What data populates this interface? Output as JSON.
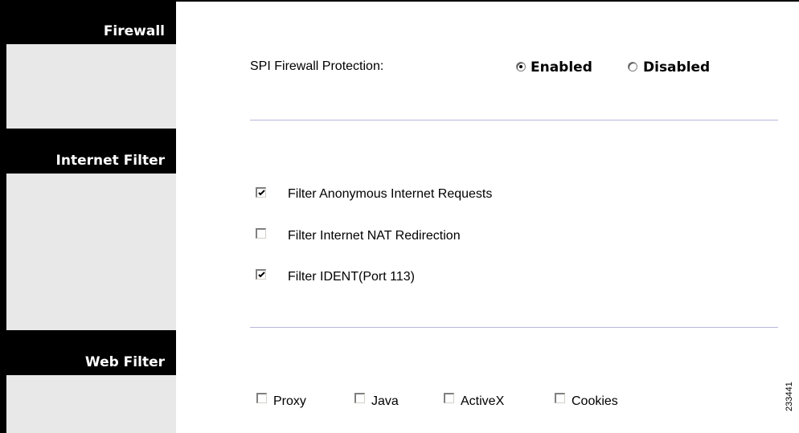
{
  "sections": {
    "firewall": "Firewall",
    "internet_filter": "Internet Filter",
    "web_filter": "Web Filter"
  },
  "firewall": {
    "label": "SPI Firewall Protection:",
    "options": [
      {
        "label": "Enabled",
        "selected": true
      },
      {
        "label": "Disabled",
        "selected": false
      }
    ]
  },
  "internet_filter": {
    "items": [
      {
        "label": "Filter Anonymous Internet Requests",
        "checked": true
      },
      {
        "label": "Filter Internet NAT Redirection",
        "checked": false
      },
      {
        "label": "Filter IDENT(Port 113)",
        "checked": true
      }
    ]
  },
  "web_filter": {
    "items": [
      {
        "label": "Proxy",
        "checked": false
      },
      {
        "label": "Java",
        "checked": false
      },
      {
        "label": "ActiveX",
        "checked": false
      },
      {
        "label": "Cookies",
        "checked": false
      }
    ]
  },
  "figure_id": "233441"
}
